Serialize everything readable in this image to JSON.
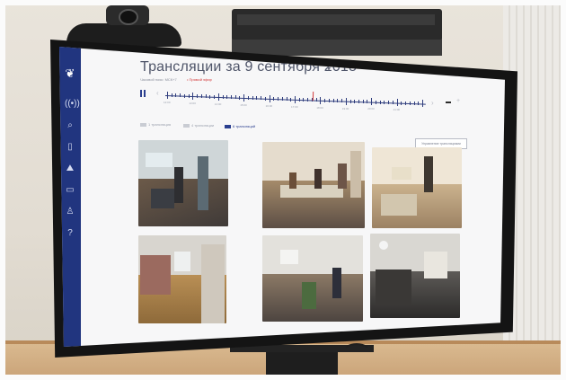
{
  "broadcast": {
    "title": "Трансляции за 9 сентября 2018",
    "title_caret": "▾",
    "subtitle": "Часовой пояс: МСК+7",
    "live_label": "• Прямой эфир",
    "play_state": "paused",
    "time_labels": [
      "12:00",
      "13:00",
      "14:00",
      "15:00",
      "16:00",
      "17:00",
      "18:00",
      "19:00",
      "20:00",
      "21:00"
    ],
    "layout_options": [
      {
        "label": "1 трансляция",
        "active": false
      },
      {
        "label": "4 трансляции",
        "active": false
      },
      {
        "label": "6 трансляций",
        "active": true
      }
    ],
    "manage_button": "Управление трансляциями"
  },
  "sidebar": {
    "logo_icon": "emblem-icon",
    "items": [
      {
        "icon": "broadcast-icon",
        "glyph": "((•))"
      },
      {
        "icon": "search-icon",
        "glyph": "⌕"
      },
      {
        "icon": "bookmark-icon",
        "glyph": "▯"
      },
      {
        "icon": "map-icon",
        "glyph": "⛰"
      },
      {
        "icon": "chat-icon",
        "glyph": "▭"
      },
      {
        "icon": "user-icon",
        "glyph": "♙"
      },
      {
        "icon": "help-icon",
        "glyph": "?"
      }
    ]
  },
  "camera_feeds": [
    {
      "scene": "polling-station-hall-1"
    },
    {
      "scene": "polling-station-room-2"
    },
    {
      "scene": "polling-station-room-3"
    },
    {
      "scene": "polling-station-room-4"
    },
    {
      "scene": "polling-station-room-5"
    },
    {
      "scene": "polling-station-room-6"
    }
  ],
  "colors": {
    "sidebar": "#21357f",
    "accent": "#2b3f8f",
    "live": "#d33b3b",
    "screen_bg": "#f7f7f8"
  }
}
